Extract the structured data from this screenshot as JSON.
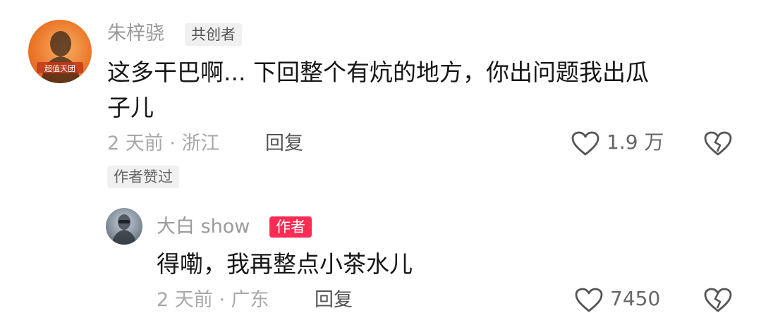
{
  "comment": {
    "username": "朱梓骁",
    "badge": "共创者",
    "text_line1": "这多干巴啊... 下回整个有炕的地方，你出问题我出瓜",
    "text_line2": "子儿",
    "time_location": "2 天前 · 浙江",
    "reply_label": "回复",
    "like_count": "1.9 万",
    "author_liked": "作者赞过"
  },
  "reply": {
    "username": "大白 show",
    "badge": "作者",
    "text": "得嘞，我再整点小茶水儿",
    "time_location": "2 天前 · 广东",
    "reply_label": "回复",
    "like_count": "7450"
  },
  "colors": {
    "author_badge": "#fe2c55",
    "username": "#9b9b9b",
    "comment_text": "#161616"
  },
  "icons": [
    "heart-icon",
    "broken-heart-icon"
  ]
}
